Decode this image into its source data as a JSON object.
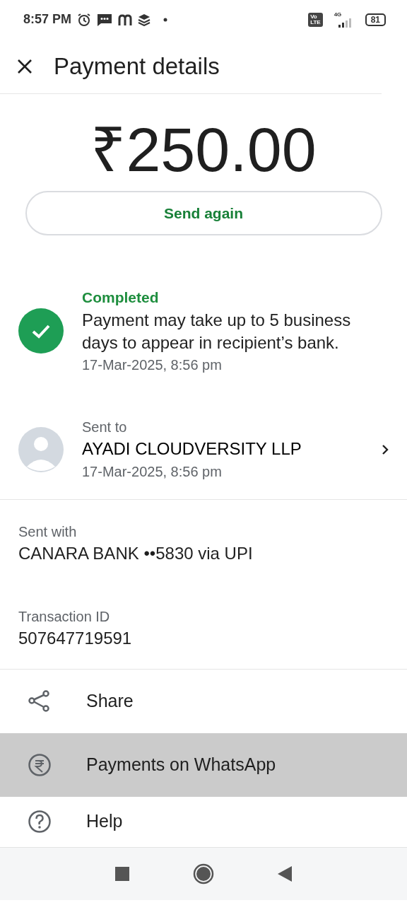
{
  "status_bar": {
    "time": "8:57 PM",
    "volte": [
      "Vo",
      "LTE"
    ],
    "network": "4G",
    "battery": "81"
  },
  "header": {
    "title": "Payment details"
  },
  "amount": "₹250.00",
  "send_again": "Send again",
  "status": {
    "label": "Completed",
    "message": "Payment may take up to 5 business days to appear in recipient’s bank.",
    "time": "17-Mar-2025, 8:56 pm"
  },
  "recipient": {
    "label": "Sent to",
    "name": "AYADI CLOUDVERSITY LLP",
    "time": "17-Mar-2025, 8:56 pm"
  },
  "details": [
    {
      "label": "Sent with",
      "value": "CANARA BANK ••5830 via UPI"
    },
    {
      "label": "Transaction ID",
      "value": "507647719591"
    }
  ],
  "actions": [
    {
      "kind": "share",
      "label": "Share",
      "selected": false
    },
    {
      "kind": "rupee",
      "label": "Payments on WhatsApp",
      "selected": true
    },
    {
      "kind": "help",
      "label": "Help",
      "selected": false
    }
  ]
}
